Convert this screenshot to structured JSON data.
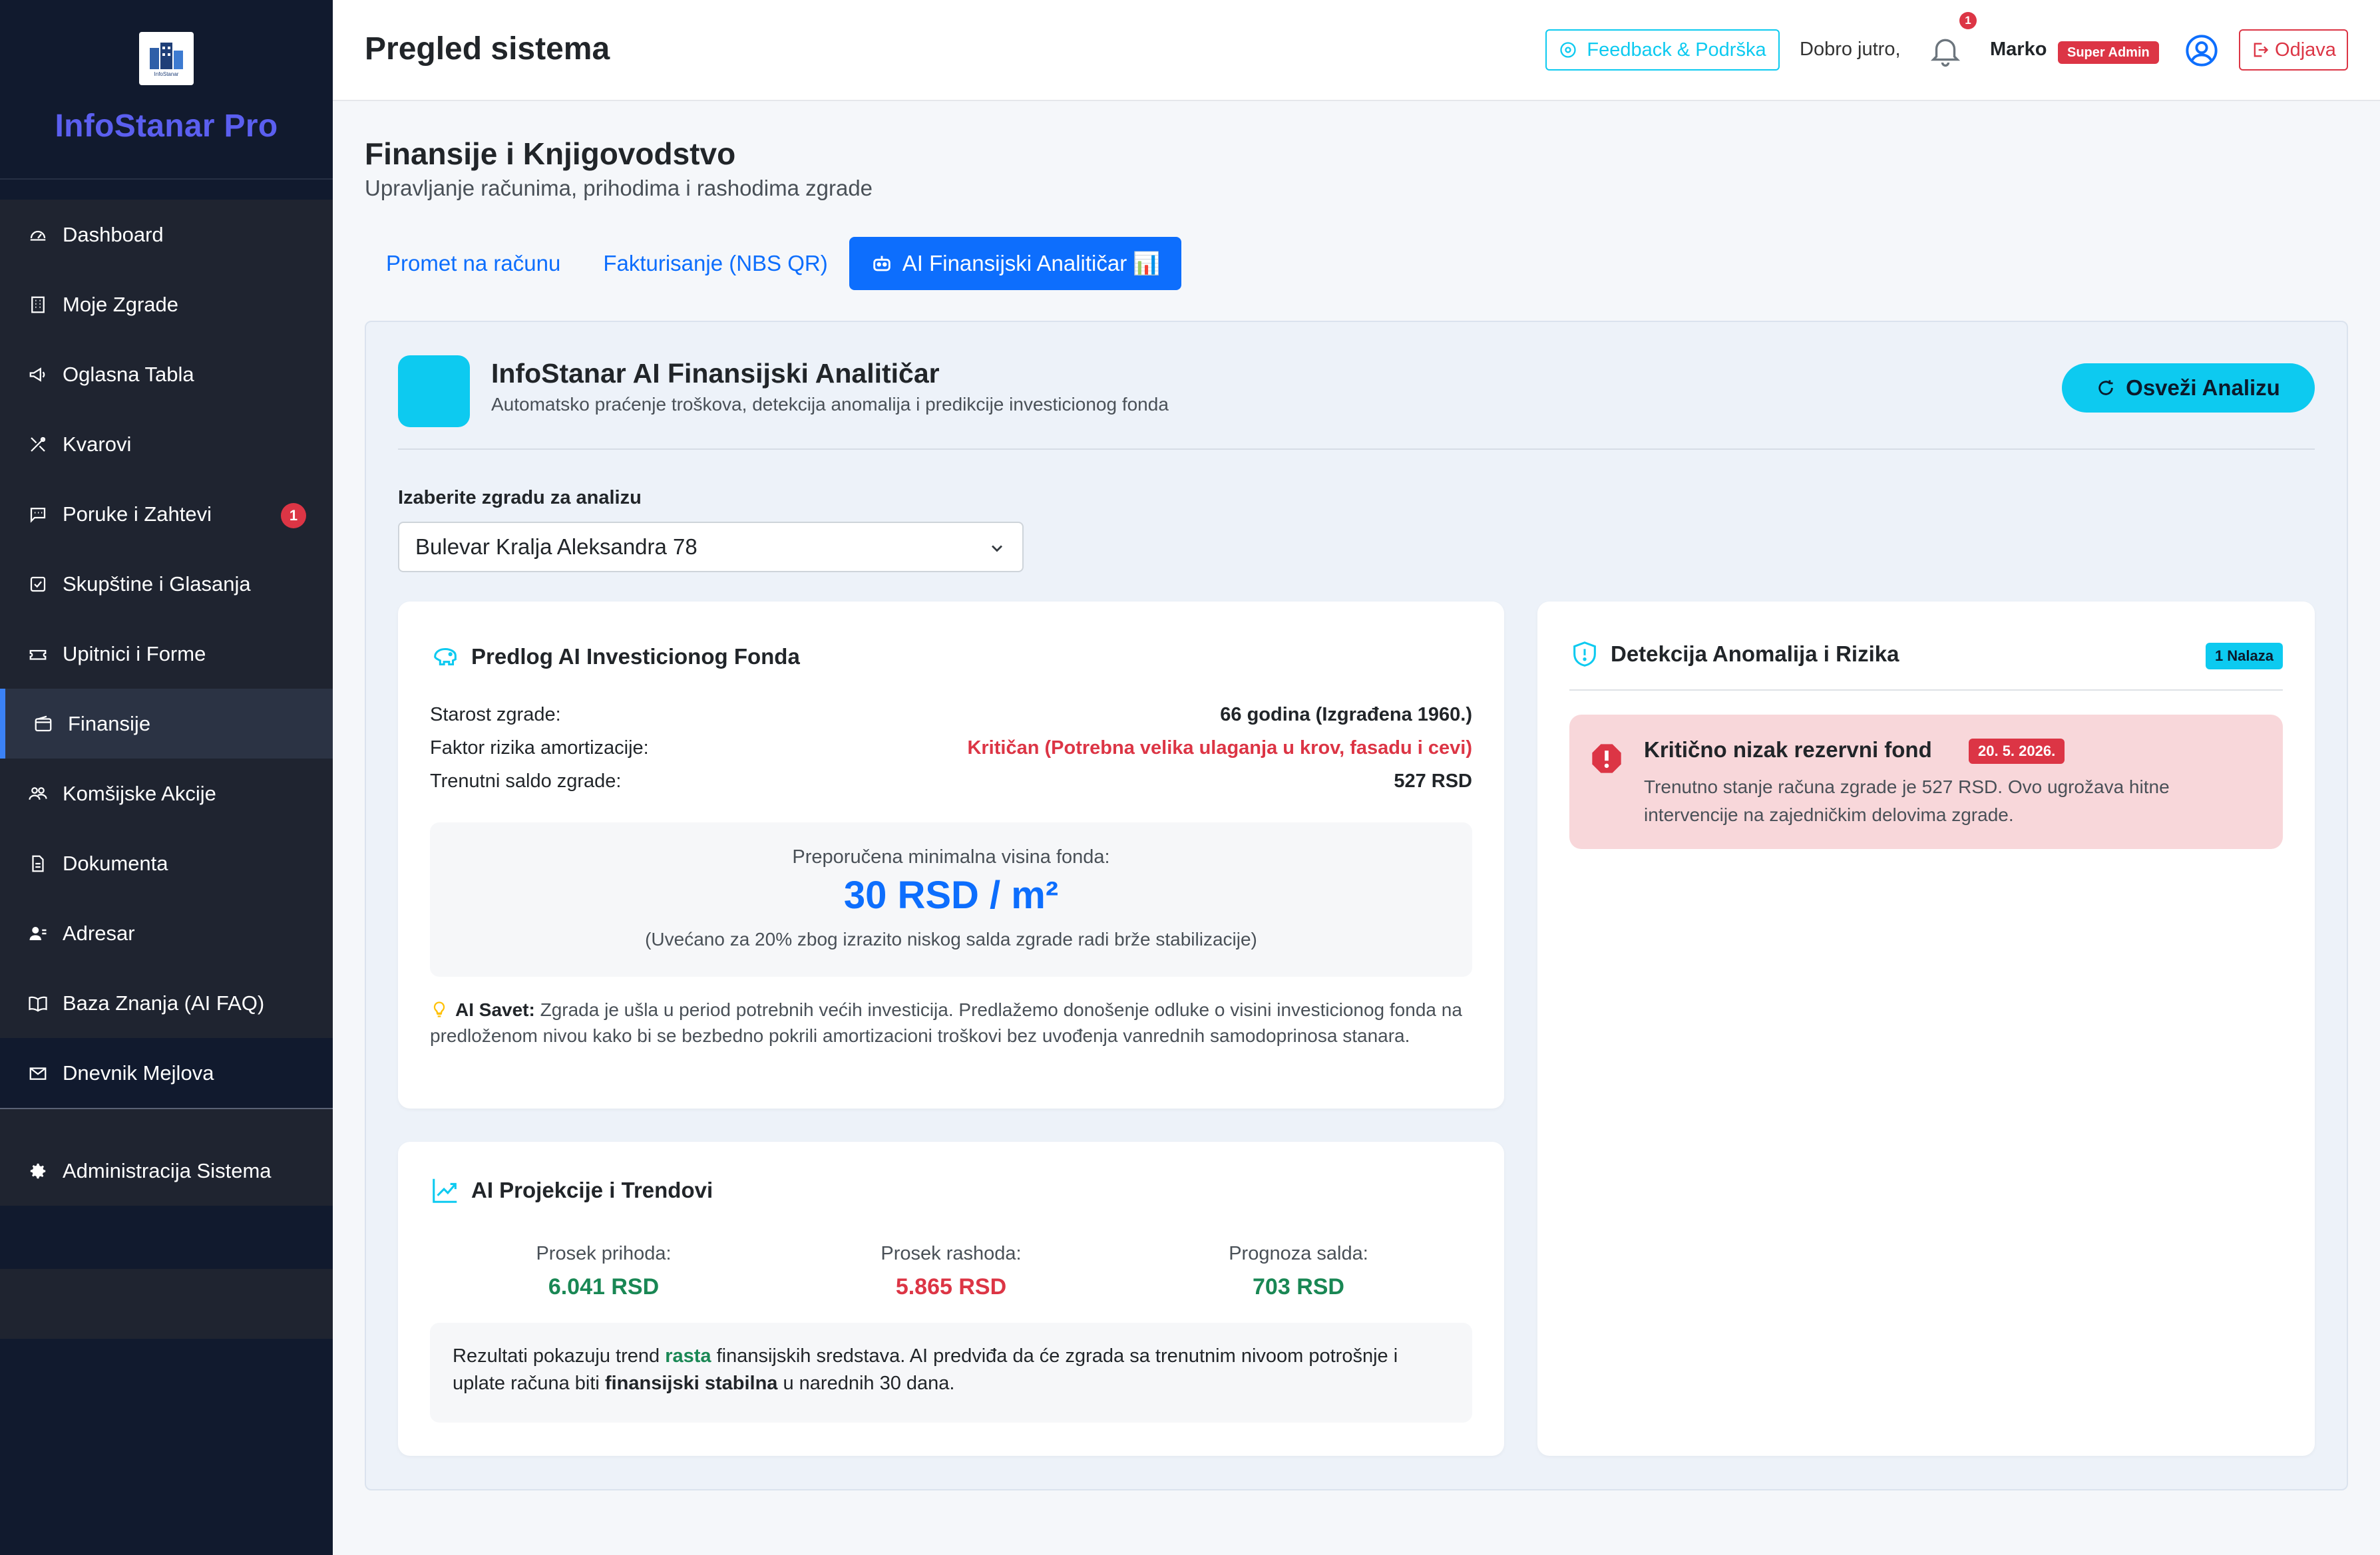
{
  "app": {
    "brand": "InfoStanar Pro",
    "logo_text": "InfoStanar"
  },
  "sidebar": {
    "items": [
      {
        "label": "Dashboard",
        "icon": "dashboard-icon"
      },
      {
        "label": "Moje Zgrade",
        "icon": "building-icon"
      },
      {
        "label": "Oglasna Tabla",
        "icon": "megaphone-icon"
      },
      {
        "label": "Kvarovi",
        "icon": "tools-icon"
      },
      {
        "label": "Poruke i Zahtevi",
        "icon": "chat-icon",
        "badge": "1"
      },
      {
        "label": "Skupštine i Glasanja",
        "icon": "checkbox-icon"
      },
      {
        "label": "Upitnici i Forme",
        "icon": "ticket-icon"
      },
      {
        "label": "Finansije",
        "icon": "wallet-icon",
        "active": true
      },
      {
        "label": "Komšijske Akcije",
        "icon": "people-icon"
      },
      {
        "label": "Dokumenta",
        "icon": "document-icon"
      },
      {
        "label": "Adresar",
        "icon": "contacts-icon"
      },
      {
        "label": "Baza Znanja (AI FAQ)",
        "icon": "book-icon"
      },
      {
        "label": "Dnevnik Mejlova",
        "icon": "envelope-icon"
      }
    ],
    "admin": {
      "label": "Administracija Sistema",
      "icon": "gear-icon"
    }
  },
  "header": {
    "title": "Pregled sistema",
    "feedback_label": "Feedback & Podrška",
    "greeting": "Dobro jutro,",
    "notification_count": "1",
    "username": "Marko",
    "role": "Super Admin",
    "logout_label": "Odjava"
  },
  "section": {
    "title": "Finansije i Knjigovodstvo",
    "subtitle": "Upravljanje računima, prihodima i rashodima zgrade",
    "tabs": [
      {
        "label": "Promet na računu"
      },
      {
        "label": "Fakturisanje (NBS QR)"
      },
      {
        "label": "AI Finansijski Analitičar 📊",
        "active": true
      }
    ]
  },
  "ai": {
    "title": "InfoStanar AI Finansijski Analitičar",
    "subtitle": "Automatsko praćenje troškova, detekcija anomalija i predikcije investicionog fonda",
    "refresh_label": "Osveži Analizu",
    "select_label": "Izaberite zgradu za analizu",
    "selected_building": "Bulevar Kralja Aleksandra 78"
  },
  "invest": {
    "title": "Predlog AI Investicionog Fonda",
    "rows": [
      {
        "label": "Starost zgrade:",
        "value": "66 godina (Izgrađena 1960.)"
      },
      {
        "label": "Faktor rizika amortizacije:",
        "value": "Kritičan (Potrebna velika ulaganja u krov, fasadu i cevi)"
      },
      {
        "label": "Trenutni saldo zgrade:",
        "value": "527 RSD"
      }
    ],
    "fund_label": "Preporučena minimalna visina fonda:",
    "fund_value": "30 RSD / m²",
    "fund_note": "(Uvećano za 20% zbog izrazito niskog salda zgrade radi brže stabilizacije)",
    "tip_label": "AI Savet:",
    "tip_text": "Zgrada je ušla u period potrebnih većih investicija. Predlažemo donošenje odluke o visini investicionog fonda na predloženom nivou kako bi se bezbedno pokrili amortizacioni troškovi bez uvođenja vanrednih samodoprinosa stanara."
  },
  "trends": {
    "title": "AI Projekcije i Trendovi",
    "stats": [
      {
        "label": "Prosek prihoda:",
        "value": "6.041 RSD"
      },
      {
        "label": "Prosek rashoda:",
        "value": "5.865 RSD"
      },
      {
        "label": "Prognoza salda:",
        "value": "703 RSD"
      }
    ],
    "text_1": "Rezultati pokazuju trend ",
    "text_trend": "rasta",
    "text_2": " finansijskih sredstava. AI predviđa da će zgrada sa trenutnim nivoom potrošnje i uplate računa biti ",
    "text_status": "finansijski stabilna",
    "text_3": " u narednih 30 dana."
  },
  "anomalies": {
    "title": "Detekcija Anomalija i Rizika",
    "count_label": "1 Nalaza",
    "alert_title": "Kritično nizak rezervni fond",
    "alert_date": "20. 5. 2026.",
    "alert_text": "Trenutno stanje računa zgrade je 527 RSD. Ovo ugrožava hitne intervencije na zajedničkim delovima zgrade."
  },
  "colors": {
    "sidebar_bg": "#111a2e",
    "brand": "#5b5ff0",
    "primary": "#0d6efd",
    "info": "#0dcaf0",
    "danger": "#dc3545",
    "success": "#198754"
  }
}
